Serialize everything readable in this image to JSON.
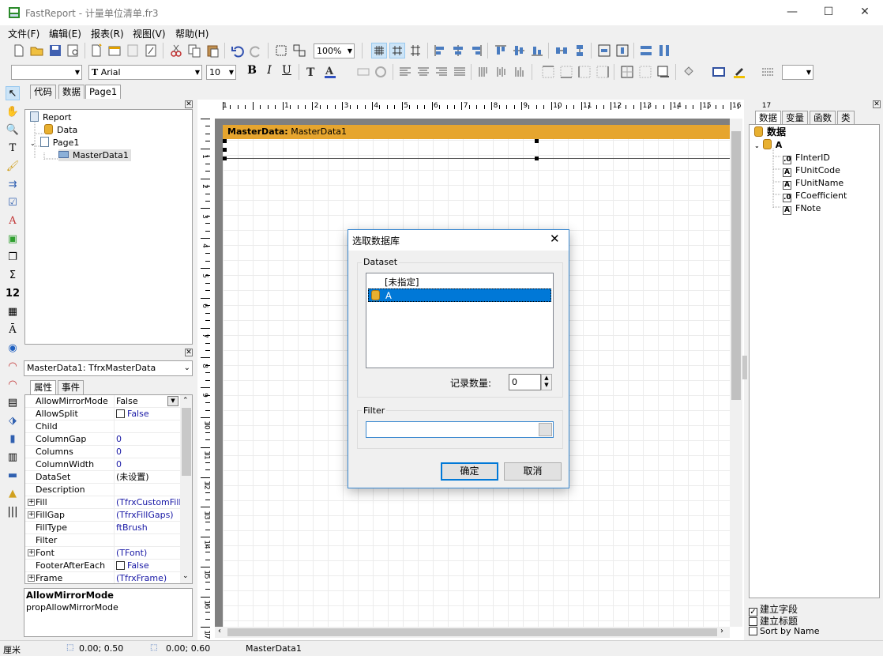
{
  "window": {
    "title": "FastReport - 计量单位清单.fr3",
    "min": "—",
    "max": "☐",
    "close": "✕"
  },
  "menu": [
    "文件(F)",
    "编辑(E)",
    "报表(R)",
    "视图(V)",
    "帮助(H)"
  ],
  "toolbar": {
    "zoom": "100%",
    "style_combo": "",
    "font_name": "Arial",
    "font_size": "10",
    "bold": "B",
    "italic": "I",
    "underline": "U"
  },
  "left_tabs": {
    "code": "代码",
    "data": "数据",
    "page": "Page1"
  },
  "report_tree": {
    "report": "Report",
    "data": "Data",
    "page": "Page1",
    "band": "MasterData1"
  },
  "object_combo": "MasterData1: TfrxMasterData",
  "prop_tabs": {
    "props": "属性",
    "events": "事件"
  },
  "properties": [
    {
      "name": "AllowMirrorMode",
      "value": "False",
      "plus": false,
      "check": false,
      "blue": false
    },
    {
      "name": "AllowSplit",
      "value": "False",
      "plus": false,
      "check": true,
      "blue": true
    },
    {
      "name": "Child",
      "value": "",
      "plus": false,
      "check": false,
      "blue": false
    },
    {
      "name": "ColumnGap",
      "value": "0",
      "plus": false,
      "check": false,
      "blue": true
    },
    {
      "name": "Columns",
      "value": "0",
      "plus": false,
      "check": false,
      "blue": true
    },
    {
      "name": "ColumnWidth",
      "value": "0",
      "plus": false,
      "check": false,
      "blue": true
    },
    {
      "name": "DataSet",
      "value": "(未设置)",
      "plus": false,
      "check": false,
      "blue": false
    },
    {
      "name": "Description",
      "value": "",
      "plus": false,
      "check": false,
      "blue": false
    },
    {
      "name": "Fill",
      "value": "(TfrxCustomFill)",
      "plus": true,
      "check": false,
      "blue": true
    },
    {
      "name": "FillGap",
      "value": "(TfrxFillGaps)",
      "plus": true,
      "check": false,
      "blue": true
    },
    {
      "name": "FillType",
      "value": "ftBrush",
      "plus": false,
      "check": false,
      "blue": true
    },
    {
      "name": "Filter",
      "value": "",
      "plus": false,
      "check": false,
      "blue": false
    },
    {
      "name": "Font",
      "value": "(TFont)",
      "plus": true,
      "check": false,
      "blue": true
    },
    {
      "name": "FooterAfterEach",
      "value": "False",
      "plus": false,
      "check": true,
      "blue": true
    },
    {
      "name": "Frame",
      "value": "(TfrxFrame)",
      "plus": true,
      "check": false,
      "blue": true
    }
  ],
  "prop_help": {
    "title": "AllowMirrorMode",
    "desc": "propAllowMirrorMode"
  },
  "ruler_h": [
    "1",
    "1",
    "2",
    "3",
    "4",
    "5",
    "6",
    "7",
    "8",
    "9",
    "10",
    "11",
    "12",
    "13",
    "14",
    "15",
    "16",
    "17"
  ],
  "ruler_v": [
    "1",
    "2",
    "3",
    "4",
    "5",
    "6",
    "7",
    "8",
    "9",
    "10",
    "11",
    "12",
    "13",
    "14",
    "15",
    "16",
    "17"
  ],
  "band": {
    "label_bold": "MasterData:",
    "label_rest": " MasterData1"
  },
  "dialog": {
    "title": "选取数据库",
    "dataset_group": "Dataset",
    "items": [
      "[未指定]",
      "A"
    ],
    "record_count_label": "记录数量:",
    "record_count_value": "0",
    "filter_group": "Filter",
    "filter_value": "",
    "ok": "确定",
    "cancel": "取消"
  },
  "right_tabs": [
    "数据",
    "变量",
    "函数",
    "类"
  ],
  "data_tree": {
    "root": "数据",
    "dataset": "A",
    "fields": [
      {
        "type": ".0",
        "name": "FInterID"
      },
      {
        "type": "A",
        "name": "FUnitCode"
      },
      {
        "type": "A",
        "name": "FUnitName"
      },
      {
        "type": ".0",
        "name": "FCoefficient"
      },
      {
        "type": "A",
        "name": "FNote"
      }
    ]
  },
  "right_options": [
    {
      "label": "建立字段",
      "checked": true
    },
    {
      "label": "建立标题",
      "checked": false
    },
    {
      "label": "Sort by Name",
      "checked": false
    }
  ],
  "status": {
    "unit": "厘米",
    "pos1": "0.00; 0.50",
    "pos2": "0.00; 0.60",
    "object": "MasterData1"
  }
}
